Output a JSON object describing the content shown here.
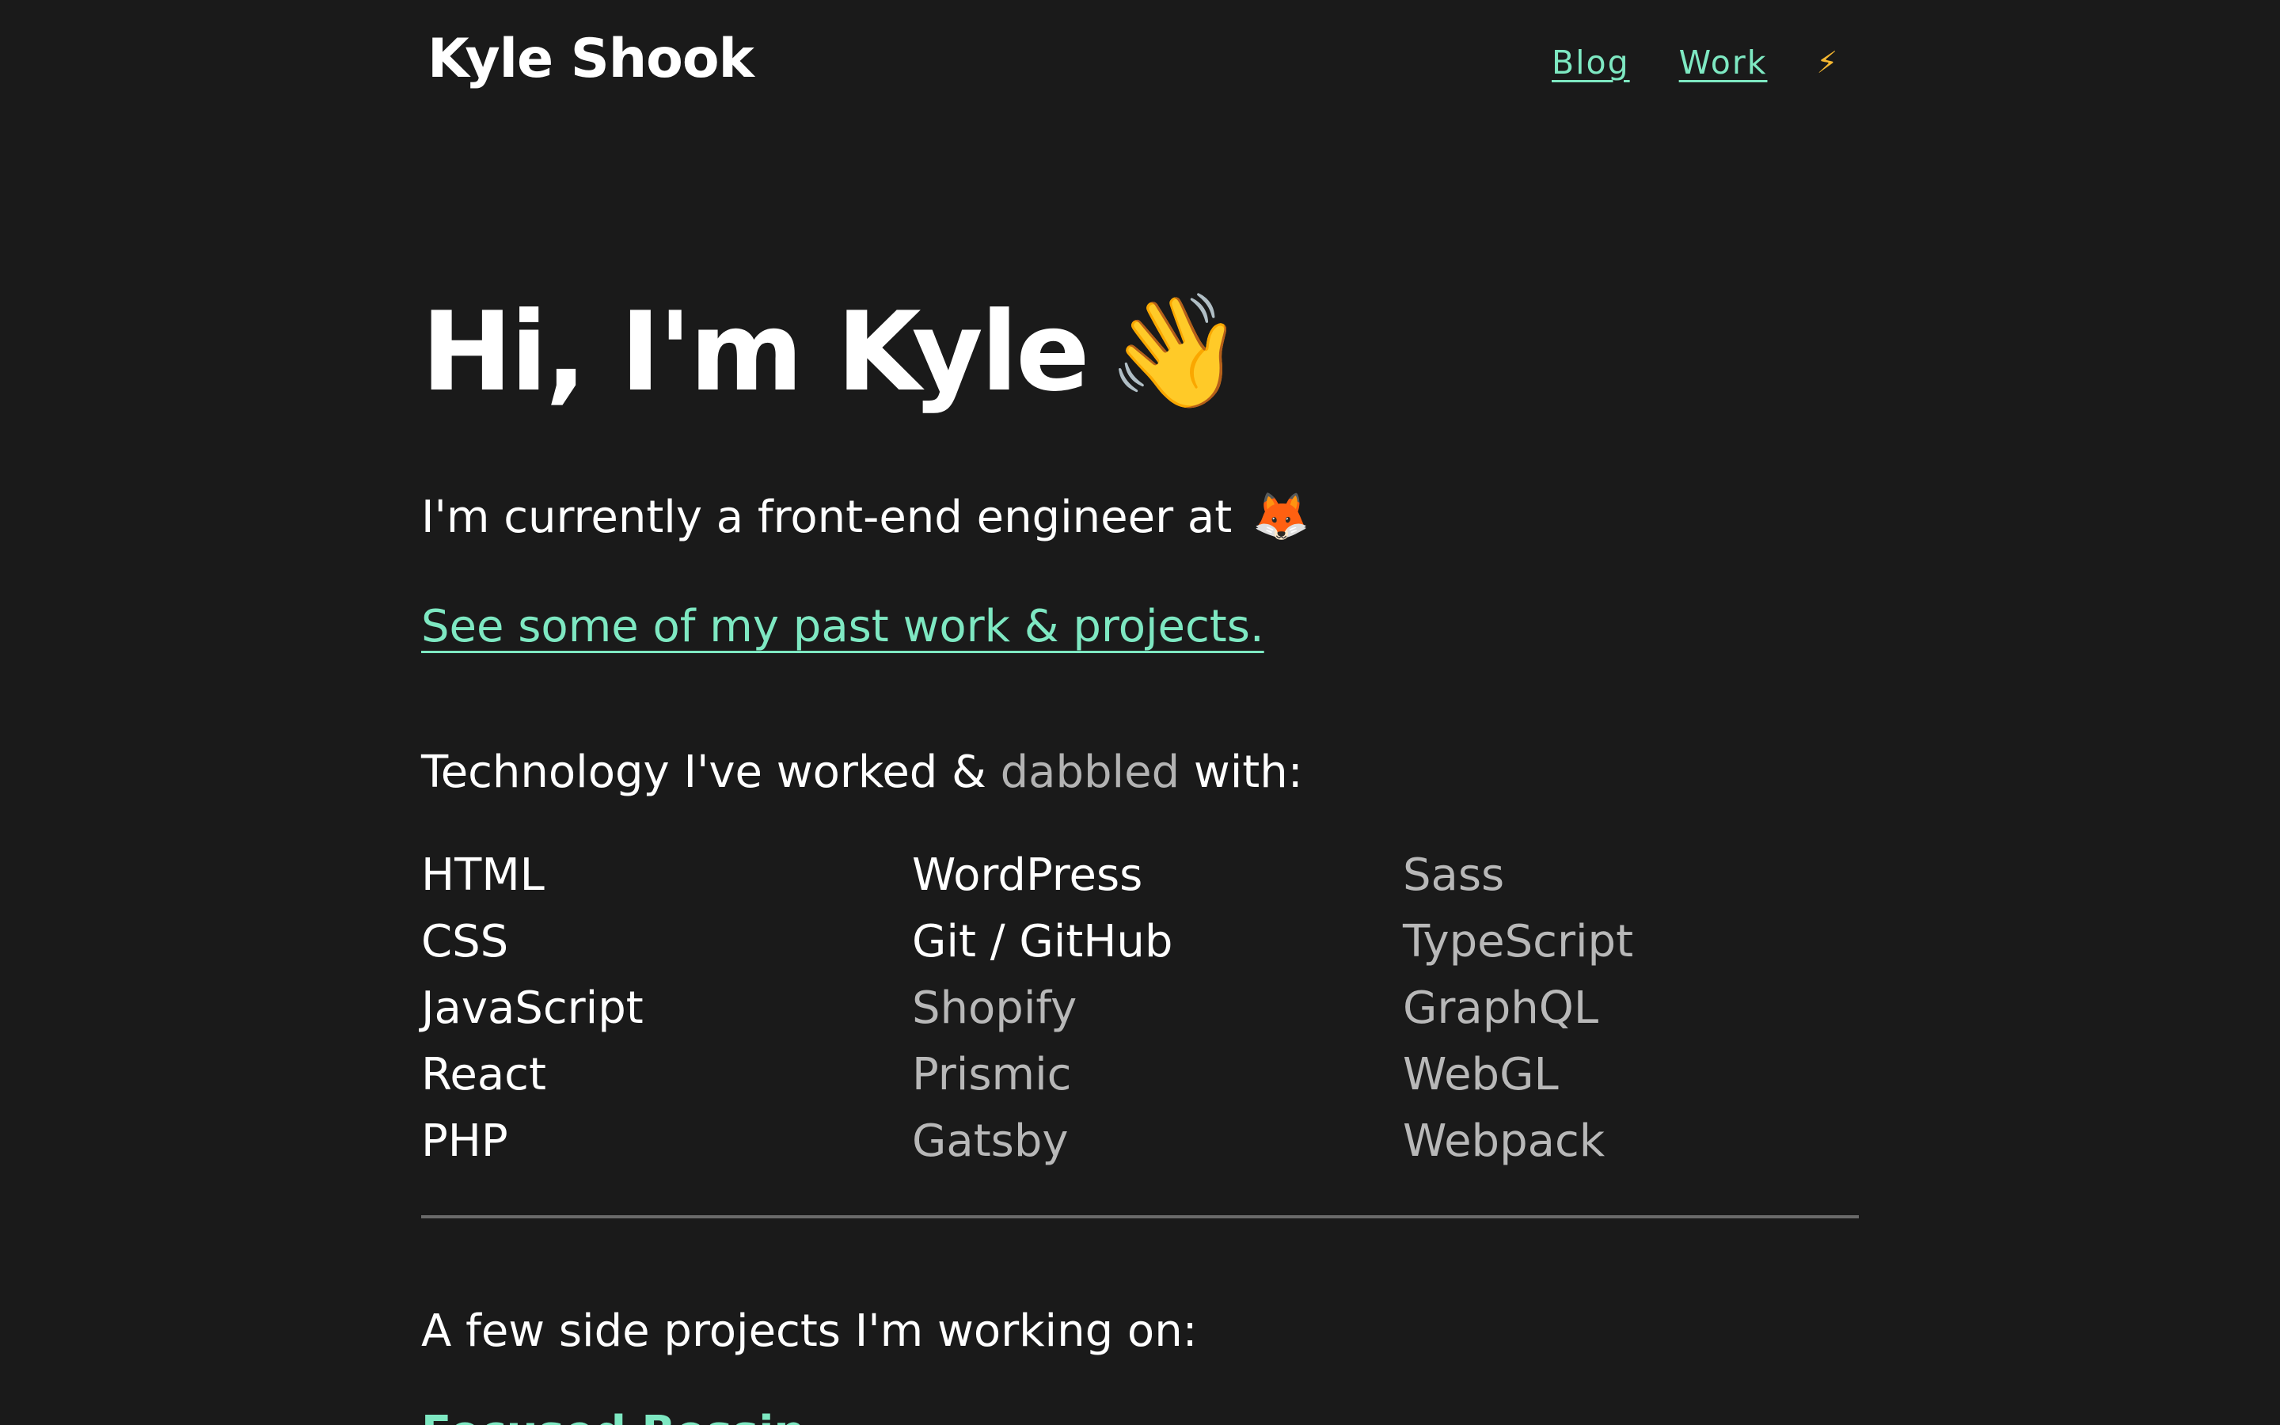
{
  "header": {
    "site_title": "Kyle Shook",
    "nav": {
      "blog_label": "Blog",
      "work_label": "Work",
      "theme_toggle_glyph": "⚡",
      "theme_toggle_icon": "lightning-bolt-icon"
    }
  },
  "hero": {
    "heading": "Hi, I'm Kyle",
    "emoji": "👋",
    "emoji_icon": "waving-hand-icon"
  },
  "intro": {
    "text": "I'm currently a front-end engineer at",
    "company_emoji": "🦊",
    "company_icon": "fox-icon"
  },
  "work_link": {
    "label": "See some of my past work & projects."
  },
  "tech": {
    "heading_start": "Technology I've worked & ",
    "heading_dabbled": "dabbled",
    "heading_end": " with:",
    "columns": [
      [
        {
          "label": "HTML",
          "kind": "worked"
        },
        {
          "label": "CSS",
          "kind": "worked"
        },
        {
          "label": "JavaScript",
          "kind": "worked"
        },
        {
          "label": "React",
          "kind": "worked"
        },
        {
          "label": "PHP",
          "kind": "worked"
        }
      ],
      [
        {
          "label": "WordPress",
          "kind": "worked"
        },
        {
          "label": "Git / GitHub",
          "kind": "worked"
        },
        {
          "label": "Shopify",
          "kind": "dabbled"
        },
        {
          "label": "Prismic",
          "kind": "dabbled"
        },
        {
          "label": "Gatsby",
          "kind": "dabbled"
        }
      ],
      [
        {
          "label": "Sass",
          "kind": "dabbled"
        },
        {
          "label": "TypeScript",
          "kind": "dabbled"
        },
        {
          "label": "GraphQL",
          "kind": "dabbled"
        },
        {
          "label": "WebGL",
          "kind": "dabbled"
        },
        {
          "label": "Webpack",
          "kind": "dabbled"
        }
      ]
    ]
  },
  "side_projects": {
    "heading": "A few side projects I'm working on:",
    "first_link_partial": "Focused Bossin"
  },
  "colors": {
    "background": "#1a1a1a",
    "text": "#ffffff",
    "accent_link": "#7ee8c2",
    "dabbled_text": "#b8b8b8",
    "divider": "#6a6a6a",
    "bolt": "#f5b731"
  }
}
